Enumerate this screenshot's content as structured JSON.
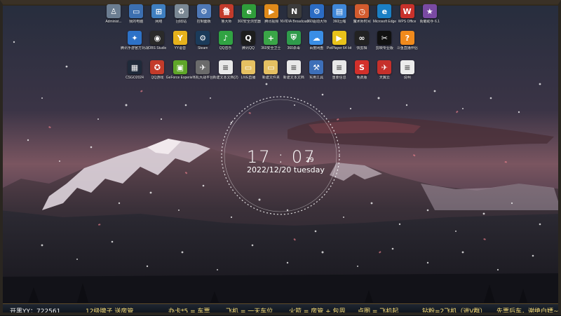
{
  "desktop": {
    "icons_row0": [
      {
        "label": "Administ...",
        "icon": "user-folder-icon",
        "color": "#6b7d91",
        "glyph": "♙"
      },
      {
        "label": "我的电脑",
        "icon": "computer-icon",
        "color": "#3c6fb0",
        "glyph": "▭"
      },
      {
        "label": "网络",
        "icon": "network-icon",
        "color": "#3f7fc0",
        "glyph": "⊞"
      },
      {
        "label": "回收站",
        "icon": "recycle-bin-icon",
        "color": "#7a8894",
        "glyph": "♻"
      },
      {
        "label": "控制面板",
        "icon": "control-panel-icon",
        "color": "#4e78b6",
        "glyph": "⚙"
      },
      {
        "label": "鲁大师",
        "icon": "master-lu-icon",
        "color": "#c23b2b",
        "glyph": "鲁"
      },
      {
        "label": "360安全浏览器",
        "icon": "360-browser-icon",
        "color": "#2f9d3a",
        "glyph": "e"
      },
      {
        "label": "腾讯视频",
        "icon": "tencent-video-icon",
        "color": "#e08a1a",
        "glyph": "▶"
      },
      {
        "label": "NVIDIA Broadcast",
        "icon": "nvidia-broadcast-icon",
        "color": "#3c3c3c",
        "glyph": "N"
      },
      {
        "label": "360驱动大师",
        "icon": "360-driver-icon",
        "color": "#2b6cc4",
        "glyph": "⚙"
      },
      {
        "label": "360压缩",
        "icon": "360-zip-icon",
        "color": "#3f87d8",
        "glyph": "▤"
      },
      {
        "label": "魔术师时间",
        "icon": "magic-time-icon",
        "color": "#d25b2e",
        "glyph": "◷"
      },
      {
        "label": "Microsoft Edge",
        "icon": "edge-icon",
        "color": "#1b7fc4",
        "glyph": "e"
      },
      {
        "label": "WPS Office",
        "icon": "wps-icon",
        "color": "#c8312b",
        "glyph": "W"
      },
      {
        "label": "街霸助手 6.1",
        "icon": "game-helper-icon",
        "color": "#7a4aa3",
        "glyph": "★"
      }
    ],
    "icons_row1": [
      {
        "label": "腾讯手游官方对战平台",
        "icon": "tencent-games-icon",
        "color": "#2d72c8",
        "glyph": "✦"
      },
      {
        "label": "OBS Studio",
        "icon": "obs-icon",
        "color": "#2a2a2a",
        "glyph": "◉"
      },
      {
        "label": "YY语音",
        "icon": "yy-icon",
        "color": "#e6b21c",
        "glyph": "Y"
      },
      {
        "label": "Steam",
        "icon": "steam-icon",
        "color": "#1b3b5a",
        "glyph": "⚙"
      },
      {
        "label": "QQ音乐",
        "icon": "qq-music-icon",
        "color": "#31a343",
        "glyph": "♪"
      },
      {
        "label": "腾讯QQ",
        "icon": "qq-icon",
        "color": "#1d1d1d",
        "glyph": "Q"
      },
      {
        "label": "360安全卫士",
        "icon": "360-safe-icon",
        "color": "#3aa547",
        "glyph": "+"
      },
      {
        "label": "360杀毒",
        "icon": "360-antivirus-icon",
        "color": "#2f9b4b",
        "glyph": "⛨"
      },
      {
        "label": "百度网盘",
        "icon": "baidu-netdisk-icon",
        "color": "#3a8ee6",
        "glyph": "☁"
      },
      {
        "label": "PotPlayer 64 bit",
        "icon": "potplayer-icon",
        "color": "#e8c21a",
        "glyph": "▶"
      },
      {
        "label": "快剪辑",
        "icon": "video-editor-icon",
        "color": "#222222",
        "glyph": "∞"
      },
      {
        "label": "剪映专业版",
        "icon": "capcut-icon",
        "color": "#111111",
        "glyph": "✂"
      },
      {
        "label": "斗鱼直播伴侣",
        "icon": "douyu-icon",
        "color": "#f08a1c",
        "glyph": "?"
      }
    ],
    "icons_row2": [
      {
        "label": "CSGO2024",
        "icon": "csgo-icon",
        "color": "#1f2a3a",
        "glyph": "▦"
      },
      {
        "label": "QQ游戏",
        "icon": "qq-game-icon",
        "color": "#c33b2a",
        "glyph": "✪"
      },
      {
        "label": "GeForce Experience",
        "icon": "geforce-icon",
        "color": "#5fa629",
        "glyph": "▣"
      },
      {
        "label": "飞机大战平台",
        "icon": "plane-game-icon",
        "color": "#6b6b6b",
        "glyph": "✈"
      },
      {
        "label": "新建文本文档(2)",
        "icon": "text-file-icon",
        "color": "#e8e8e8",
        "glyph": "≡"
      },
      {
        "label": "LIVE直播",
        "icon": "folder-icon",
        "color": "#e5c062",
        "glyph": "▭"
      },
      {
        "label": "新建文件夹",
        "icon": "folder-icon",
        "color": "#e5c062",
        "glyph": "▭"
      },
      {
        "label": "新建文本文档",
        "icon": "text-file-icon",
        "color": "#e8e8e8",
        "glyph": "≡"
      },
      {
        "label": "实用工具",
        "icon": "tools-icon",
        "color": "#3d6fb8",
        "glyph": "⚒"
      },
      {
        "label": "重要信息",
        "icon": "document-icon",
        "color": "#e8e8e8",
        "glyph": "≡"
      },
      {
        "label": "免费版",
        "icon": "free-app-icon",
        "color": "#d2302b",
        "glyph": "S"
      },
      {
        "label": "天翼云",
        "icon": "cloud-app-icon",
        "color": "#c5302b",
        "glyph": "✈"
      },
      {
        "label": "说明",
        "icon": "readme-icon",
        "color": "#ececec",
        "glyph": "≡"
      }
    ]
  },
  "clock": {
    "hour": "17",
    "minute": "07",
    "seconds": "29",
    "date": "2022/12/20 tuesday"
  },
  "bottom_bar": {
    "items": [
      {
        "text": "开黑YY：722561",
        "style": "white"
      },
      {
        "text": "12级牌子 送房管",
        "style": "yellow"
      },
      {
        "text": "办卡*5 = 车票",
        "style": "yellow"
      },
      {
        "text": "飞机 = 一天车位",
        "style": "yellow"
      },
      {
        "text": "火箭 = 房管 + 包周",
        "style": "yellow"
      },
      {
        "text": "点图 = 飞机起",
        "style": "yellow"
      },
      {
        "text": "钻粉=2飞机（进V群）",
        "style": "yellow"
      },
      {
        "text": "先票后车，谢绝白嫖~",
        "style": "yellow"
      }
    ]
  },
  "colors": {
    "sky_top": "#2c3345",
    "sky_mid": "#4a3b4c",
    "sky_glow": "#8a5b64",
    "mountain": "#2a2430",
    "snow": "#e9e3ea",
    "ticker_text": "#ffe27a"
  }
}
